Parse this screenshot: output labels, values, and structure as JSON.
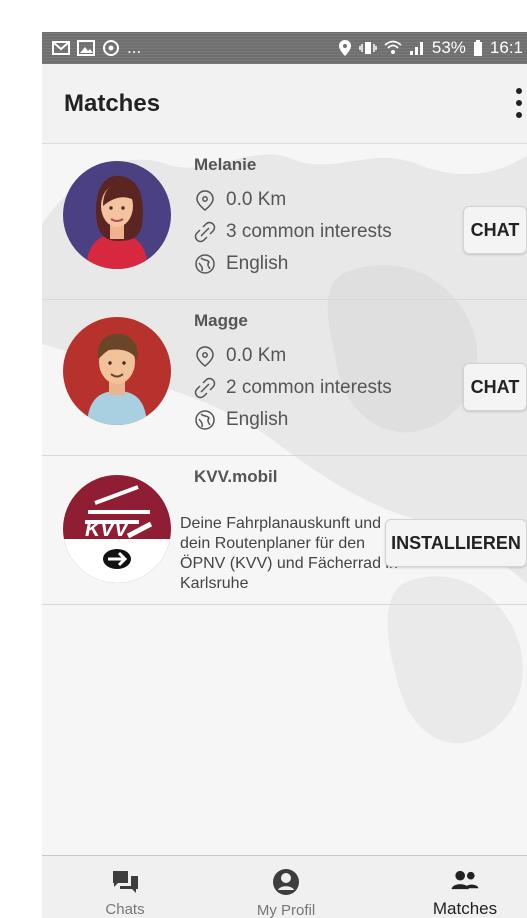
{
  "status_bar": {
    "battery": "53%",
    "time": "16:1"
  },
  "app_bar": {
    "title": "Matches"
  },
  "matches": [
    {
      "name": "Melanie",
      "distance": "0.0 Km",
      "interests": "3 common interests",
      "language": "English",
      "button": "CHAT"
    },
    {
      "name": "Magge",
      "distance": "0.0 Km",
      "interests": "2 common interests",
      "language": "English",
      "button": "CHAT"
    }
  ],
  "ad": {
    "name": "KVV.mobil",
    "description": "Deine Fahrplanauskunft und dein Routenplaner für den ÖPNV (KVV) und Fächerrad in Karlsruhe",
    "button": "INSTALLIEREN",
    "logo_text": "KVV"
  },
  "bottom_nav": [
    {
      "label": "Chats",
      "icon": "chat-icon"
    },
    {
      "label": "My Profil",
      "icon": "user-icon"
    },
    {
      "label": "Matches",
      "icon": "group-icon",
      "active": true
    }
  ],
  "colors": {
    "ad_logo": "#8f1d34",
    "avatar_purple": "#4b4182",
    "avatar_red": "#b7312d"
  }
}
